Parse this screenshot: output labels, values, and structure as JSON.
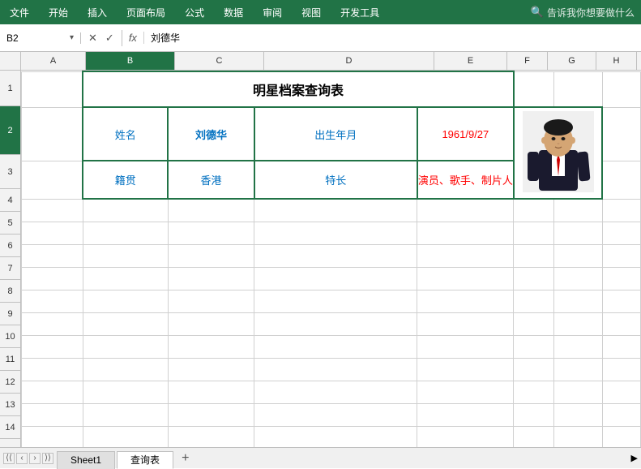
{
  "ribbon": {
    "menu_items": [
      "文件",
      "开始",
      "插入",
      "页面布局",
      "公式",
      "数据",
      "审阅",
      "视图",
      "开发工具"
    ],
    "search_icon": "🔍",
    "search_placeholder": "告诉我你想要做什么"
  },
  "formula_bar": {
    "cell_ref": "B2",
    "formula_value": "刘德华"
  },
  "columns": {
    "headers": [
      "A",
      "B",
      "C",
      "D",
      "E",
      "F",
      "G",
      "H"
    ],
    "widths": [
      80,
      110,
      110,
      210,
      90,
      50,
      60,
      50
    ]
  },
  "rows": {
    "numbers": [
      "1",
      "2",
      "3",
      "4",
      "5",
      "6",
      "7",
      "8",
      "9",
      "10",
      "11",
      "12",
      "13",
      "14"
    ],
    "height": 30
  },
  "star_table": {
    "title": "明星档案查询表",
    "name_label": "姓名",
    "name_value": "刘德华",
    "birth_label": "出生年月",
    "birth_value": "1961/9/27",
    "origin_label": "籍贯",
    "origin_value": "香港",
    "skill_label": "特长",
    "skill_value": "演员、歌手、制片人"
  },
  "tabs": {
    "items": [
      "Sheet1",
      "查询表"
    ],
    "active": "查询表",
    "add_label": "+"
  },
  "colors": {
    "ribbon_green": "#217346",
    "blue_text": "#0070c0",
    "red_text": "#ff0000",
    "selected_col": "#217346"
  }
}
